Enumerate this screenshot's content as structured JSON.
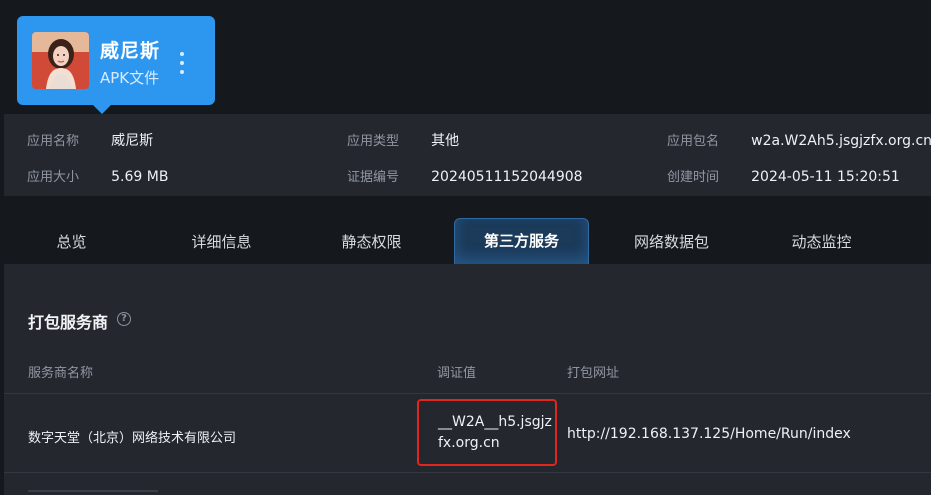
{
  "app": {
    "name": "威尼斯",
    "type": "APK文件"
  },
  "info": {
    "app_name_label": "应用名称",
    "app_name_value": "威尼斯",
    "app_type_label": "应用类型",
    "app_type_value": "其他",
    "package_label": "应用包名",
    "package_value": "w2a.W2Ah5.jsgjzfx.org.cn",
    "size_label": "应用大小",
    "size_value": "5.69 MB",
    "evidence_label": "证据编号",
    "evidence_value": "20240511152044908",
    "created_label": "创建时间",
    "created_value": "2024-05-11 15:20:51"
  },
  "tabs": [
    {
      "label": "总览"
    },
    {
      "label": "详细信息"
    },
    {
      "label": "静态权限"
    },
    {
      "label": "第三方服务",
      "active": true
    },
    {
      "label": "网络数据包"
    },
    {
      "label": "动态监控"
    }
  ],
  "section": {
    "title": "打包服务商",
    "help_icon": "question-circle-icon"
  },
  "table": {
    "headers": [
      "服务商名称",
      "调证值",
      "打包网址"
    ],
    "rows": [
      {
        "provider": "数字天堂（北京）网络技术有限公司",
        "cert_value": "__W2A__h5.jsgjzfx.org.cn",
        "url": "http://192.168.137.125/Home/Run/index"
      }
    ]
  },
  "colors": {
    "accent": "#2d97f0",
    "highlight": "#e0261d",
    "panel": "#24272e",
    "background": "#15181d"
  }
}
